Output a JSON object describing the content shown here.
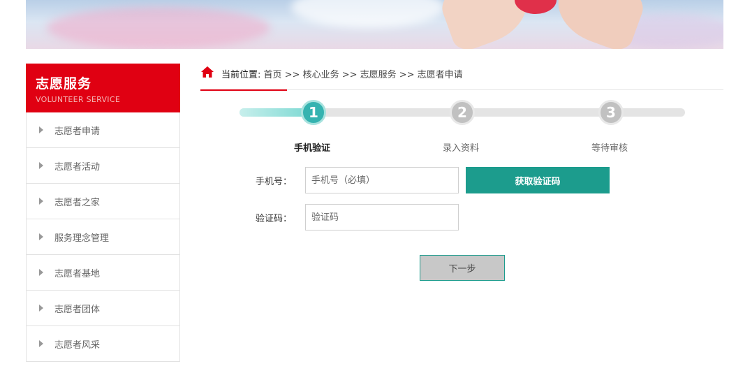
{
  "sidebar": {
    "title": "志愿服务",
    "subtitle": "VOLUNTEER SERVICE",
    "items": [
      {
        "label": "志愿者申请"
      },
      {
        "label": "志愿者活动"
      },
      {
        "label": "志愿者之家"
      },
      {
        "label": "服务理念管理"
      },
      {
        "label": "志愿者基地"
      },
      {
        "label": "志愿者团体"
      },
      {
        "label": "志愿者风采"
      }
    ]
  },
  "breadcrumb": {
    "label": "当前位置:",
    "path": " 首页 >> 核心业务 >> 志愿服务 >> 志愿者申请"
  },
  "steps": [
    {
      "number": "1",
      "label": "手机验证",
      "state": "active"
    },
    {
      "number": "2",
      "label": "录入资料",
      "state": "pending"
    },
    {
      "number": "3",
      "label": "等待审核",
      "state": "pending"
    }
  ],
  "form": {
    "phone_label": "手机号：",
    "phone_placeholder": "手机号（必填）",
    "phone_value": "",
    "code_label": "验证码：",
    "code_placeholder": "验证码",
    "code_value": "",
    "get_code_button": "获取验证码",
    "next_button": "下一步"
  },
  "colors": {
    "brand_red": "#e00012",
    "accent_teal": "#1c9c8d"
  }
}
